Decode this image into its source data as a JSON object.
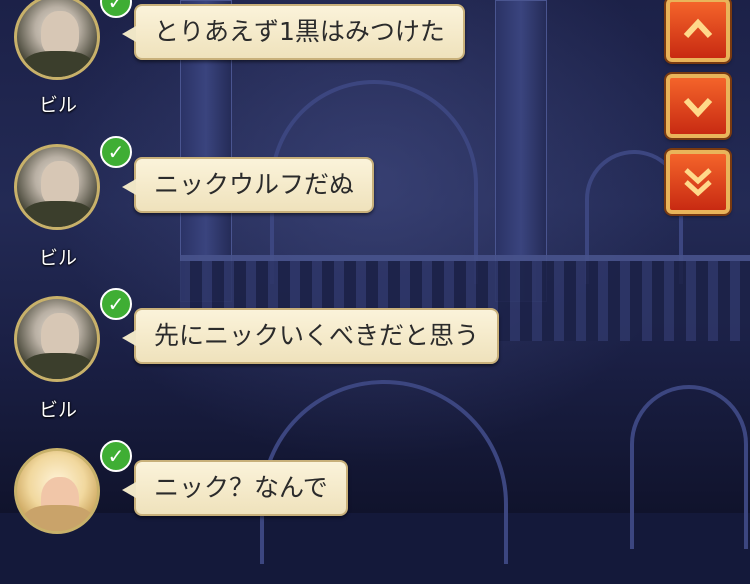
{
  "messages": [
    {
      "speaker": "ビル",
      "text": "とりあえず1黒はみつけた",
      "avatar": "old-man",
      "checked": true
    },
    {
      "speaker": "ビル",
      "text": "ニックウルフだぬ",
      "avatar": "old-man",
      "checked": true
    },
    {
      "speaker": "ビル",
      "text": "先にニックいくべきだと思う",
      "avatar": "old-man",
      "checked": true
    },
    {
      "speaker": "",
      "text": "ニック？なんで",
      "avatar": "blonde-woman",
      "checked": true
    }
  ],
  "nav": {
    "scroll_up_icon": "chevron-up-icon",
    "scroll_down_icon": "chevron-down-icon",
    "scroll_bottom_icon": "double-chevron-down-icon"
  },
  "colors": {
    "bubble": "#fbf3da",
    "check": "#3fae34",
    "nav": "#e04a1e",
    "gold": "#e9b45a"
  }
}
